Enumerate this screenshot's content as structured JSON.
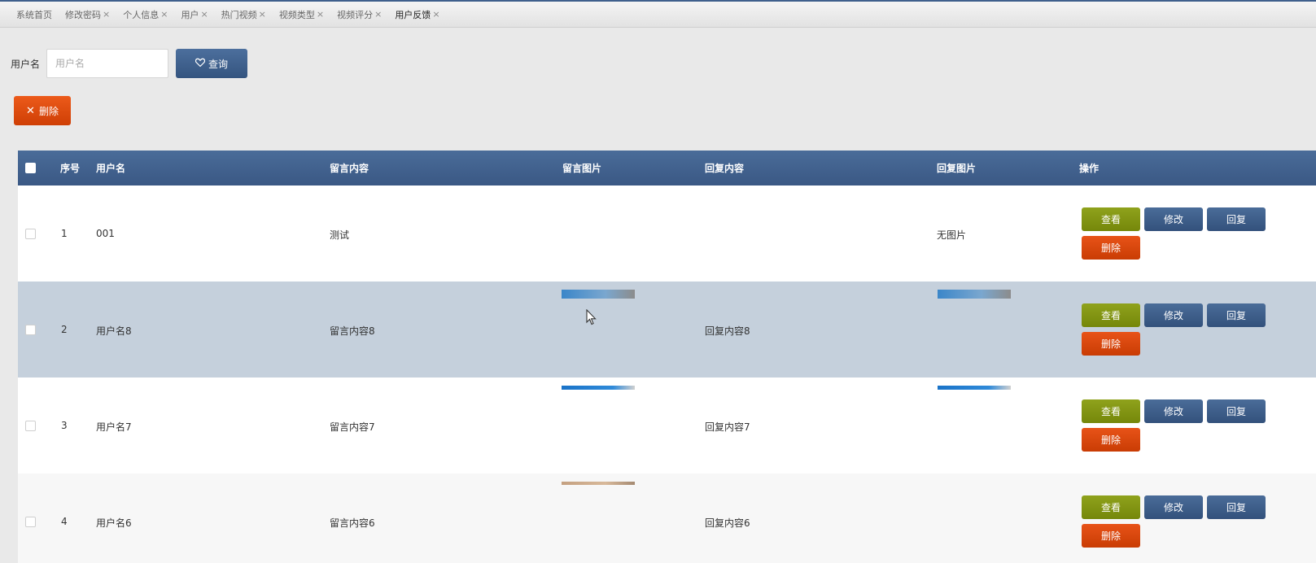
{
  "tabs": [
    {
      "label": "系统首页",
      "closable": false,
      "active": false
    },
    {
      "label": "修改密码",
      "closable": true,
      "active": false
    },
    {
      "label": "个人信息",
      "closable": true,
      "active": false
    },
    {
      "label": "用户",
      "closable": true,
      "active": false
    },
    {
      "label": "热门视频",
      "closable": true,
      "active": false
    },
    {
      "label": "视频类型",
      "closable": true,
      "active": false
    },
    {
      "label": "视频评分",
      "closable": true,
      "active": false
    },
    {
      "label": "用户反馈",
      "closable": true,
      "active": true
    }
  ],
  "close_glyph": "×",
  "search": {
    "label": "用户名",
    "placeholder": "用户名",
    "value": "",
    "button_label": "查询",
    "button_icon": "heart-icon"
  },
  "toolbar": {
    "delete_label": "删除",
    "delete_icon": "close-icon"
  },
  "table": {
    "headers": {
      "index": "序号",
      "username": "用户名",
      "message": "留言内容",
      "message_image": "留言图片",
      "reply": "回复内容",
      "reply_image": "回复图片",
      "actions": "操作"
    },
    "action_labels": {
      "view": "查看",
      "edit": "修改",
      "reply": "回复",
      "delete": "删除"
    },
    "rows": [
      {
        "index": "1",
        "username": "001",
        "message": "测试",
        "message_image": "",
        "reply": "",
        "reply_image": "无图片"
      },
      {
        "index": "2",
        "username": "用户名8",
        "message": "留言内容8",
        "message_image": "image",
        "reply": "回复内容8",
        "reply_image": "image"
      },
      {
        "index": "3",
        "username": "用户名7",
        "message": "留言内容7",
        "message_image": "image",
        "reply": "回复内容7",
        "reply_image": "image"
      },
      {
        "index": "4",
        "username": "用户名6",
        "message": "留言内容6",
        "message_image": "image",
        "reply": "回复内容6",
        "reply_image": ""
      }
    ]
  },
  "colors": {
    "header_bg": "#3f5f8c",
    "view_button": "#809512",
    "edit_button": "#3f5f8c",
    "delete_button": "#d8460b",
    "hover_row": "#c5d0dc"
  }
}
